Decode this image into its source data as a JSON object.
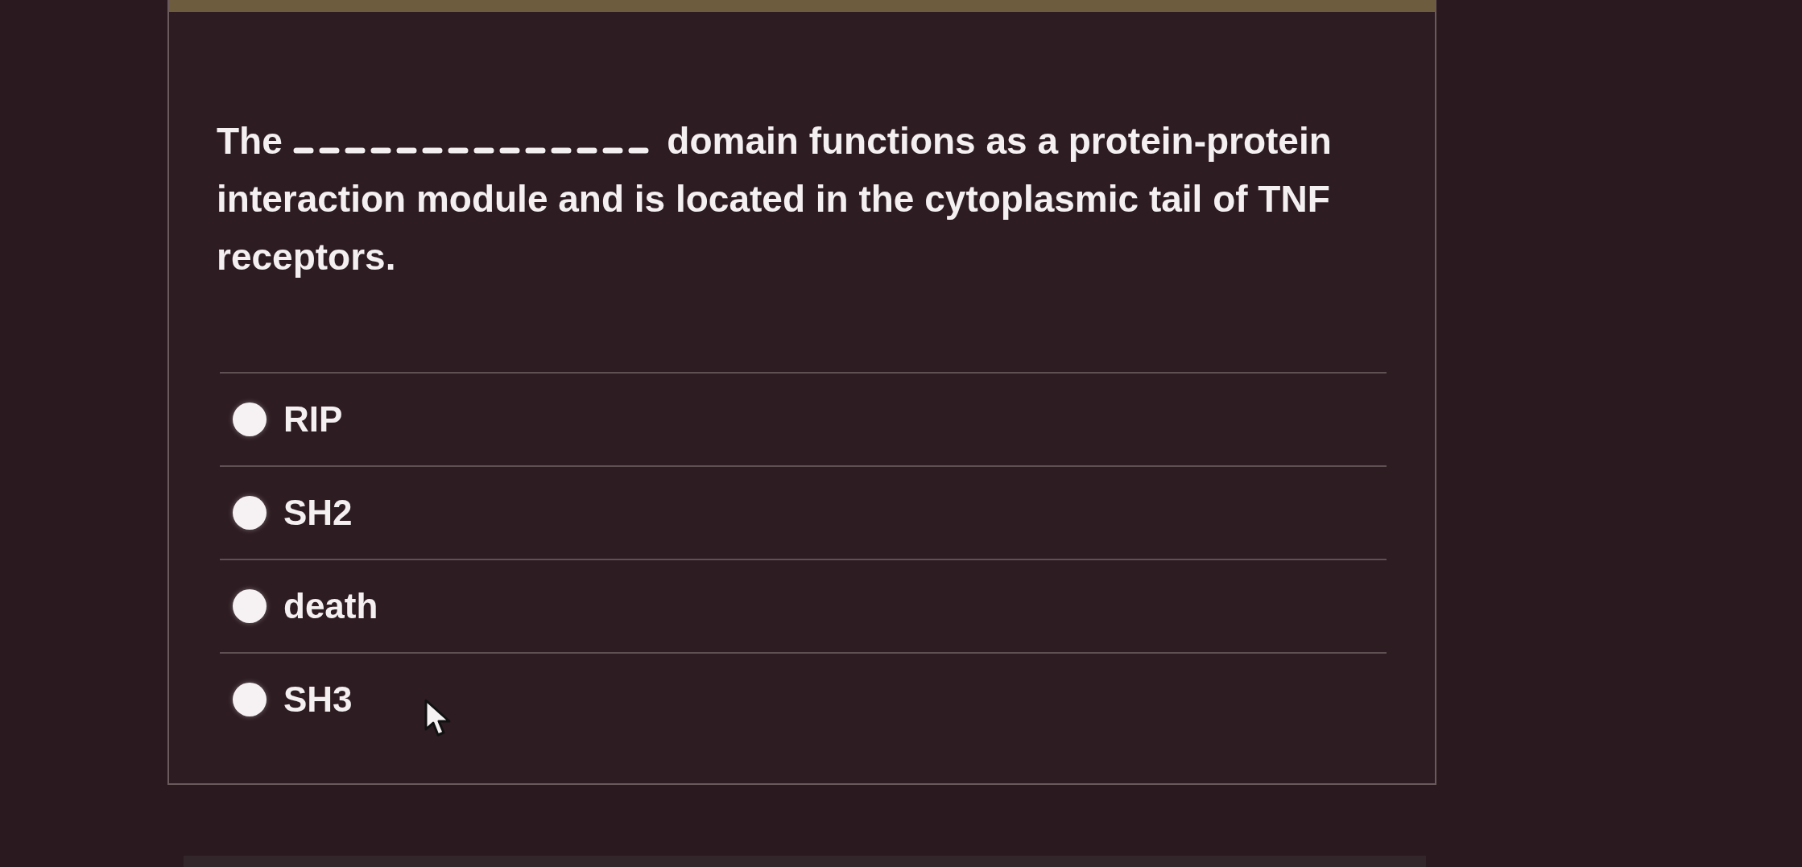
{
  "question": {
    "text_start": "The",
    "text_end": [
      "domain functions as a protein-protein",
      "interaction module and is located in the cytoplasmic tail of TNF receptors."
    ]
  },
  "options": [
    {
      "label": "RIP",
      "selected": false
    },
    {
      "label": "SH2",
      "selected": false
    },
    {
      "label": "death",
      "selected": false
    },
    {
      "label": "SH3",
      "selected": false
    }
  ]
}
